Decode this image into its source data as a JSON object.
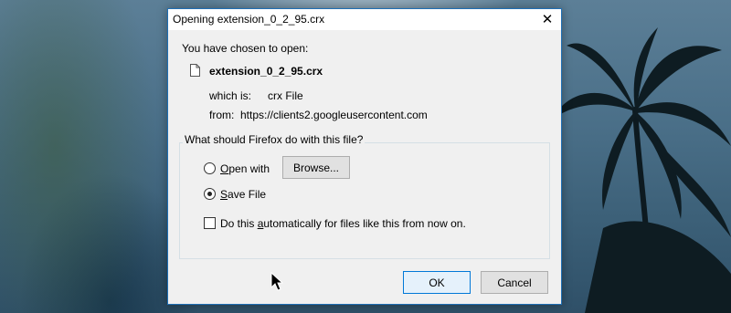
{
  "dialog": {
    "title": "Opening extension_0_2_95.crx",
    "intro": "You have chosen to open:",
    "file_name": "extension_0_2_95.crx",
    "which_is_label": "which is:",
    "which_is_value": "crx File",
    "from_label": "from:",
    "from_value": "https://clients2.googleusercontent.com",
    "question": "What should Firefox do with this file?",
    "open_with_label": "Open with",
    "open_with_selected": false,
    "browse_label": "Browse...",
    "save_file_label": "Save File",
    "save_file_selected": true,
    "auto_label": "Do this automatically for files like this from now on.",
    "auto_checked": false,
    "ok_label": "OK",
    "cancel_label": "Cancel"
  },
  "icons": {
    "close": "close-icon",
    "file": "file-icon",
    "cursor": "mouse-pointer-icon"
  },
  "colors": {
    "accent": "#0078d7",
    "dialog_border": "#1f6fb5",
    "dialog_bg": "#f0f0f0"
  }
}
